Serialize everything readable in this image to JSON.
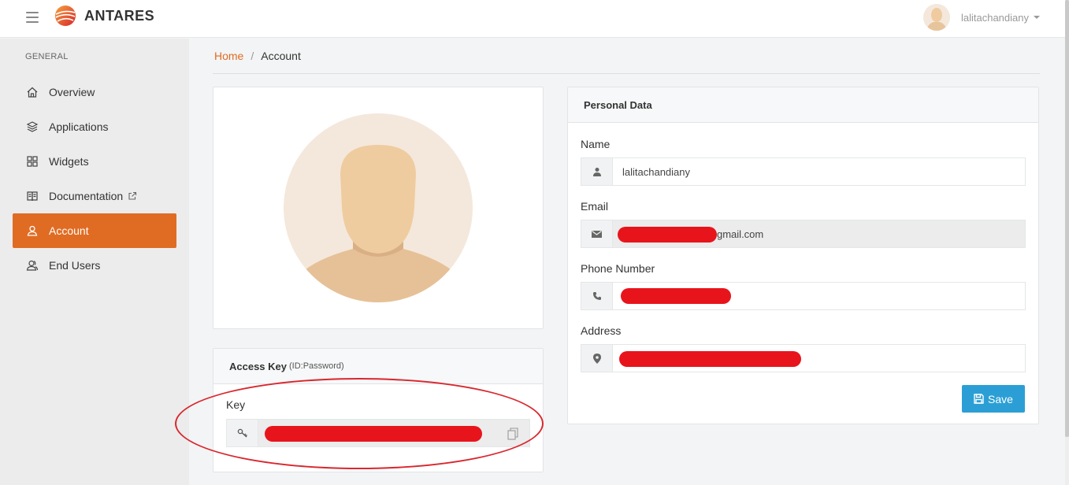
{
  "header": {
    "brand": "ANTARES",
    "username": "lalitachandiany",
    "icons": {
      "menu": "hamburger-menu-icon",
      "logo": "antares-logo-icon"
    }
  },
  "sidebar": {
    "heading": "GENERAL",
    "items": [
      {
        "label": "Overview",
        "icon": "home-icon",
        "active": false
      },
      {
        "label": "Applications",
        "icon": "layers-icon",
        "active": false
      },
      {
        "label": "Widgets",
        "icon": "grid-icon",
        "active": false
      },
      {
        "label": "Documentation",
        "icon": "book-icon",
        "active": false,
        "external": true
      },
      {
        "label": "Account",
        "icon": "user-icon",
        "active": true
      },
      {
        "label": "End Users",
        "icon": "users-icon",
        "active": false
      }
    ]
  },
  "breadcrumb": {
    "home": "Home",
    "separator": "/",
    "current": "Account"
  },
  "access_key": {
    "title": "Access Key",
    "subtitle": "(ID:Password)",
    "key_label": "Key",
    "key_value_redacted": true
  },
  "personal": {
    "title": "Personal Data",
    "name_label": "Name",
    "name_value": "lalitachandiany",
    "email_label": "Email",
    "email_suffix": "gmail.com",
    "phone_label": "Phone Number",
    "address_label": "Address",
    "save_label": "Save"
  },
  "colors": {
    "accent": "#e06c23",
    "save": "#2b9fd5",
    "redaction": "#e8141c",
    "annotation_oval": "#d9272e"
  }
}
